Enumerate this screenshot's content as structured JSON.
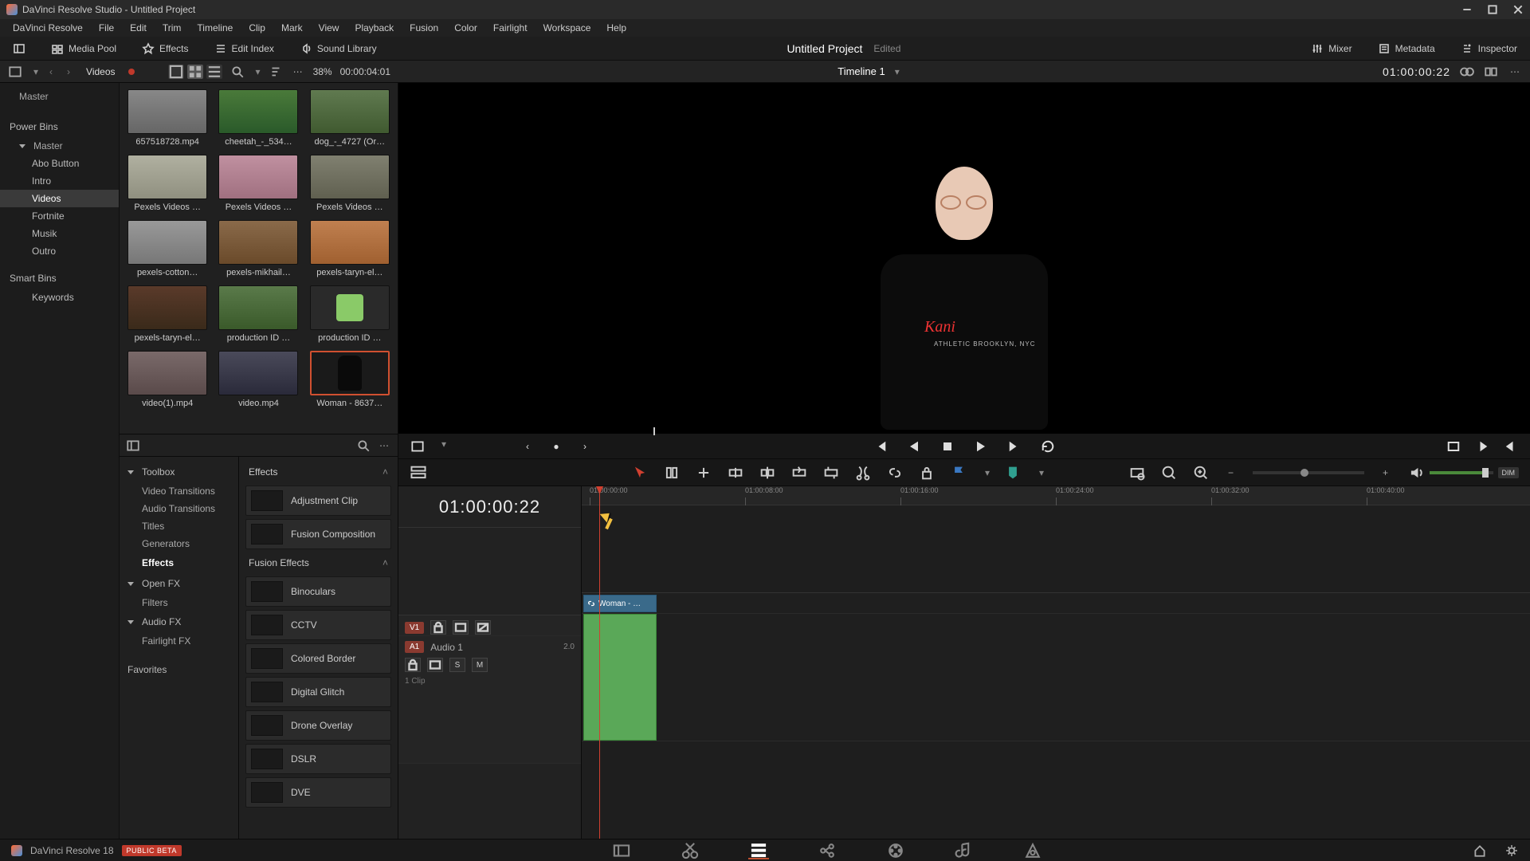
{
  "window": {
    "title": "DaVinci Resolve Studio - Untitled Project"
  },
  "menubar": [
    "DaVinci Resolve",
    "File",
    "Edit",
    "Trim",
    "Timeline",
    "Clip",
    "Mark",
    "View",
    "Playback",
    "Fusion",
    "Color",
    "Fairlight",
    "Workspace",
    "Help"
  ],
  "toolbar": {
    "media_pool": "Media Pool",
    "effects": "Effects",
    "edit_index": "Edit Index",
    "sound_library": "Sound Library",
    "mixer": "Mixer",
    "metadata": "Metadata",
    "inspector": "Inspector"
  },
  "project": {
    "name": "Untitled Project",
    "status": "Edited"
  },
  "subheader": {
    "bin_label": "Videos",
    "zoom_pct": "38%",
    "source_tc": "00:00:04:01",
    "timeline_name": "Timeline 1",
    "record_tc": "01:00:00:22"
  },
  "bins": {
    "master": "Master",
    "power_bins_header": "Power Bins",
    "pb_master": "Master",
    "children": [
      "Abo Button",
      "Intro",
      "Videos",
      "Fortnite",
      "Musik",
      "Outro"
    ],
    "active_child": "Videos",
    "smart_bins_header": "Smart Bins",
    "smart_children": [
      "Keywords"
    ]
  },
  "clips": [
    {
      "name": "657518728.mp4",
      "t": "t1"
    },
    {
      "name": "cheetah_-_534…",
      "t": "t2"
    },
    {
      "name": "dog_-_4727 (Or…",
      "t": "t3"
    },
    {
      "name": "Pexels Videos …",
      "t": "t4"
    },
    {
      "name": "Pexels Videos …",
      "t": "t5"
    },
    {
      "name": "Pexels Videos …",
      "t": "t6"
    },
    {
      "name": "pexels-cotton…",
      "t": "t7"
    },
    {
      "name": "pexels-mikhail…",
      "t": "t8"
    },
    {
      "name": "pexels-taryn-el…",
      "t": "t9"
    },
    {
      "name": "pexels-taryn-el…",
      "t": "t10"
    },
    {
      "name": "production ID …",
      "t": "t11"
    },
    {
      "name": "production ID …",
      "t": "t12"
    },
    {
      "name": "video(1).mp4",
      "t": "t13"
    },
    {
      "name": "video.mp4",
      "t": "t14"
    },
    {
      "name": "Woman - 8637…",
      "t": "t15",
      "selected": true
    }
  ],
  "fx_tree": {
    "toolbox": "Toolbox",
    "toolbox_children": [
      "Video Transitions",
      "Audio Transitions",
      "Titles",
      "Generators",
      "Effects"
    ],
    "toolbox_active": "Effects",
    "openfx": "Open FX",
    "openfx_children": [
      "Filters"
    ],
    "audiofx": "Audio FX",
    "audiofx_children": [
      "Fairlight FX"
    ],
    "favorites": "Favorites"
  },
  "fx_groups": {
    "effects_header": "Effects",
    "effects_items": [
      "Adjustment Clip",
      "Fusion Composition"
    ],
    "fusion_header": "Fusion Effects",
    "fusion_items": [
      "Binoculars",
      "CCTV",
      "Colored Border",
      "Digital Glitch",
      "Drone Overlay",
      "DSLR",
      "DVE"
    ]
  },
  "viewer": {
    "shirt_logo": "Kani",
    "shirt_sub": "ATHLETIC BROOKLYN, NYC"
  },
  "timeline": {
    "tc": "01:00:00:22",
    "ruler": [
      "01:00:00:00",
      "01:00:08:00",
      "01:00:16:00",
      "01:00:24:00",
      "01:00:32:00",
      "01:00:40:00"
    ],
    "v1": {
      "badge": "V1"
    },
    "a1": {
      "badge": "A1",
      "name": "Audio 1",
      "ch": "2.0",
      "clips_label": "1 Clip",
      "solo": "S",
      "mute": "M"
    },
    "clip_v_label": "Woman - …",
    "dim": "DIM"
  },
  "bottombar": {
    "app": "DaVinci Resolve 18",
    "beta": "PUBLIC BETA"
  }
}
